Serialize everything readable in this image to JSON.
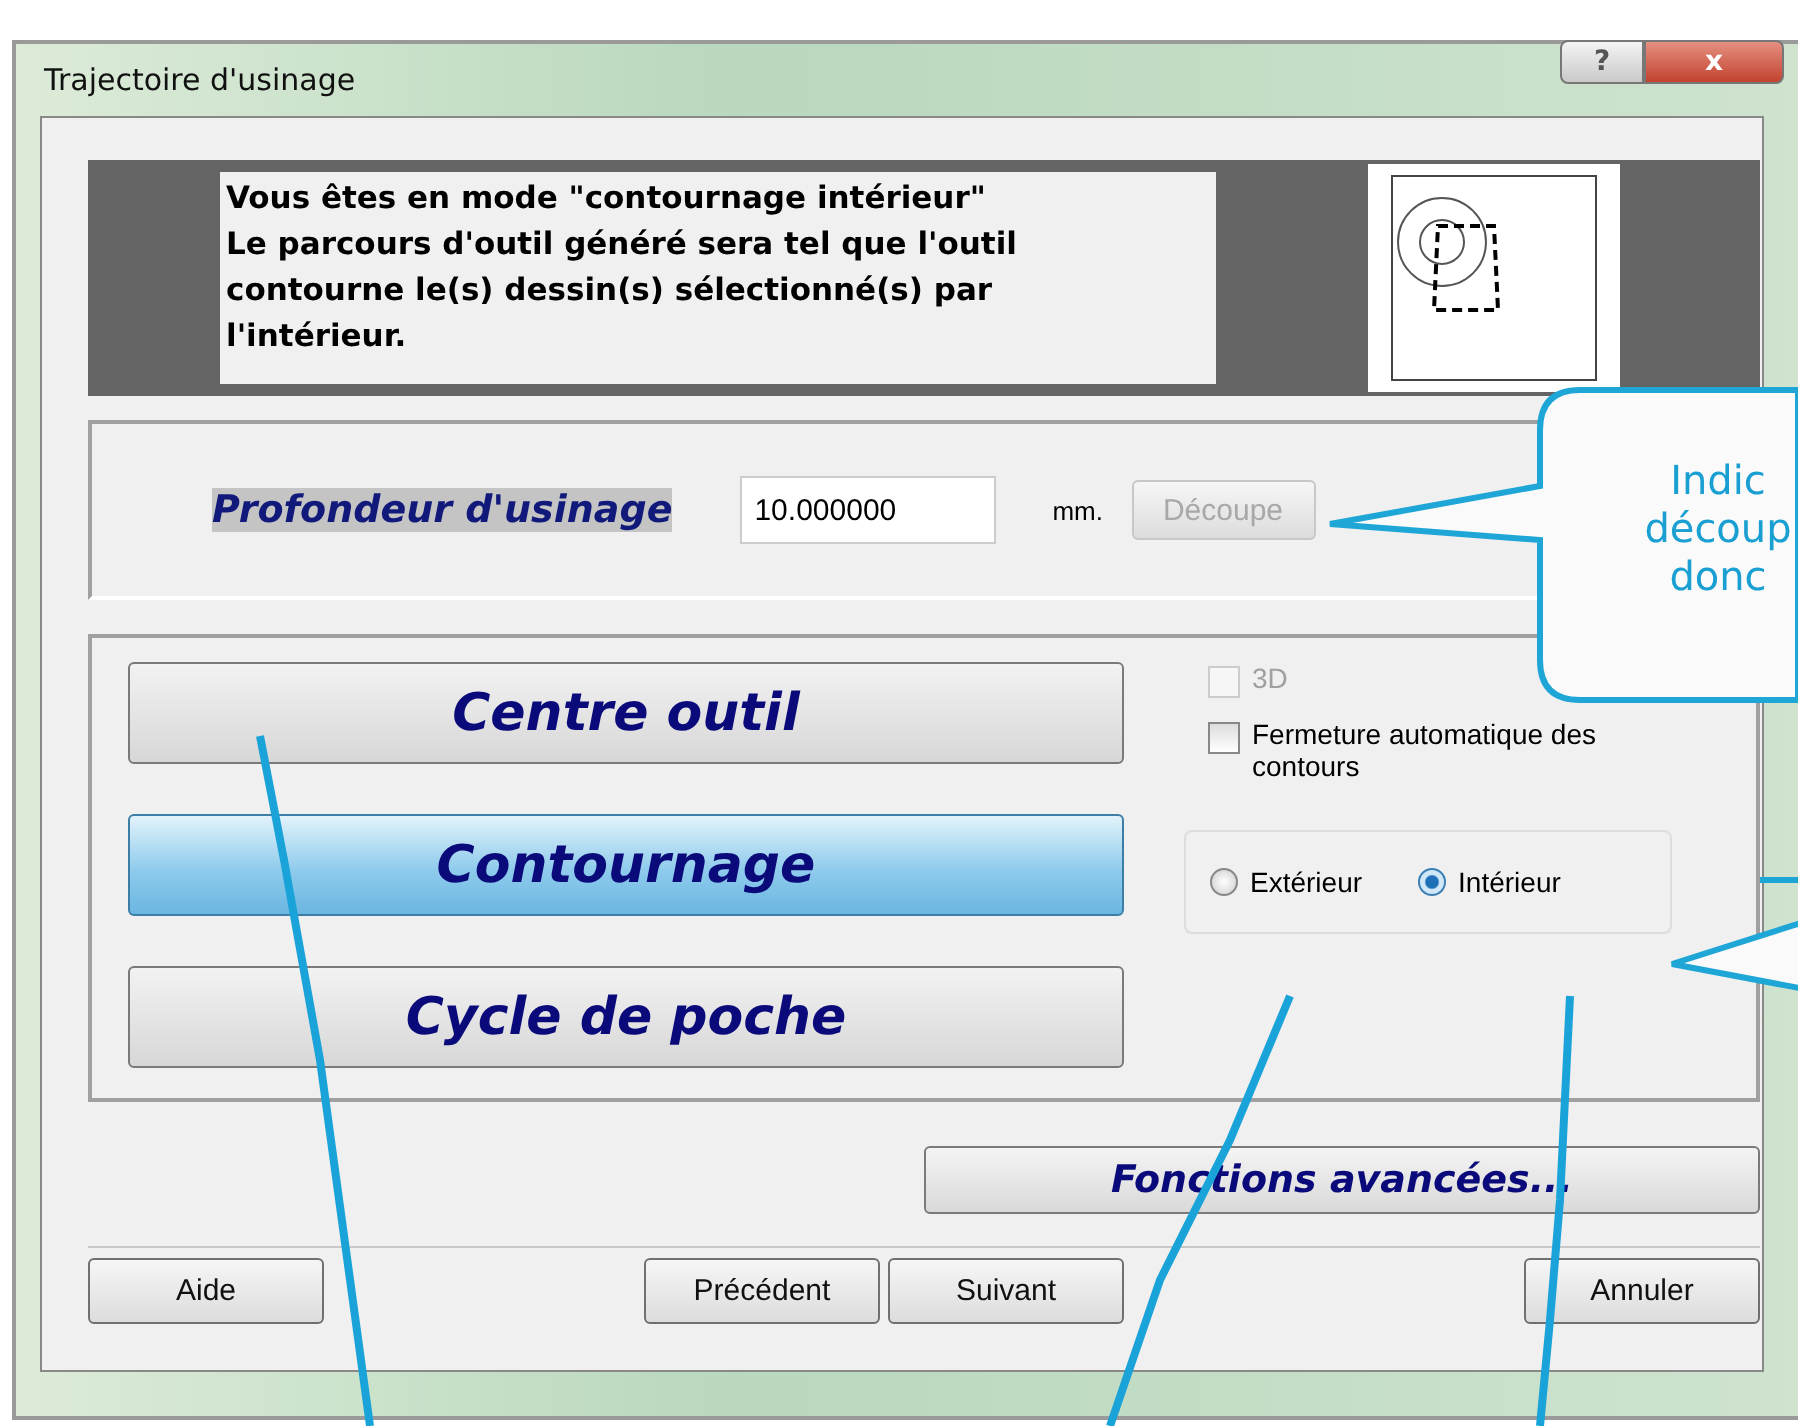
{
  "window": {
    "title": "Trajectoire d'usinage",
    "help_button": "?",
    "close_button": "x"
  },
  "info": {
    "lines": [
      "Vous êtes en mode \"contournage intérieur\"",
      "Le parcours d'outil généré sera tel que l'outil",
      "contourne le(s) dessin(s) sélectionné(s) par",
      "l'intérieur."
    ]
  },
  "depth": {
    "label": "Profondeur d'usinage",
    "value": "10.000000",
    "unit": "mm.",
    "cut_button": {
      "label": "Découpe",
      "disabled": true
    }
  },
  "modes": [
    {
      "label": "Centre outil",
      "selected": false
    },
    {
      "label": "Contournage",
      "selected": true
    },
    {
      "label": "Cycle de poche",
      "selected": false
    }
  ],
  "options": [
    {
      "label": "3D",
      "checked": false,
      "disabled": true
    },
    {
      "label": "Fermeture automatique des contours",
      "checked": false,
      "disabled": false
    }
  ],
  "sides": [
    {
      "label": "Extérieur",
      "selected": false
    },
    {
      "label": "Intérieur",
      "selected": true
    }
  ],
  "advanced_button": "Fonctions avancées...",
  "footer_buttons": [
    "Aide",
    "Précédent",
    "Suivant",
    "Annuler"
  ],
  "callout": {
    "lines": [
      "Indic",
      "découp",
      "donc"
    ]
  }
}
